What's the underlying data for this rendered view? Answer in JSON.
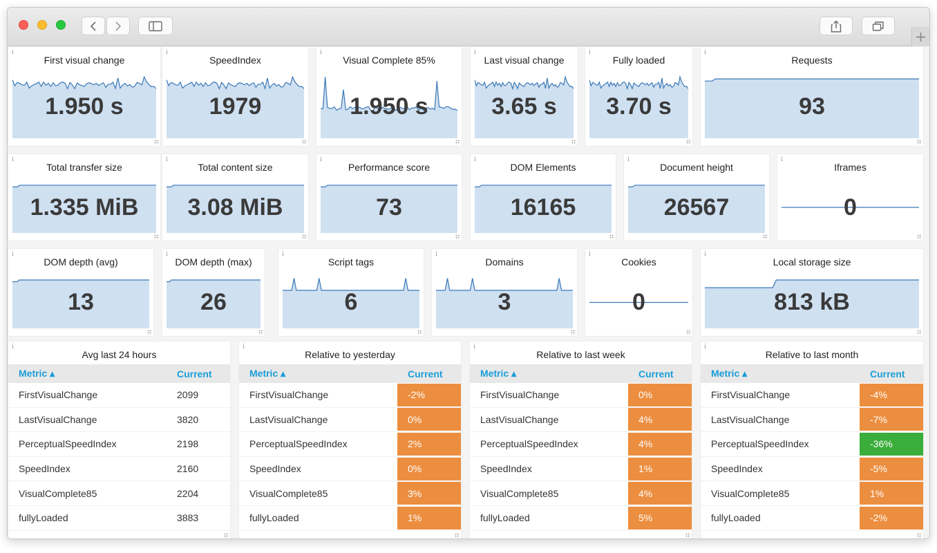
{
  "colors": {
    "spark_fill": "#cfe0f1",
    "spark_line": "#3b78b6",
    "orange": "#ec8e3f",
    "green": "#3aad3a",
    "header_blue": "#1a9ed8"
  },
  "toolbar": {
    "back_icon": "chevron-left-icon",
    "forward_icon": "chevron-right-icon",
    "sidebar_icon": "sidebar-icon",
    "share_icon": "share-icon",
    "tabs_icon": "tabs-icon",
    "new_tab": "+"
  },
  "info_glyph": "i",
  "panels": [
    {
      "title": "First visual change",
      "value": "1.950 s"
    },
    {
      "title": "SpeedIndex",
      "value": "1979"
    },
    {
      "title": "Visual Complete 85%",
      "value": "1.950 s"
    },
    {
      "title": "Last visual change",
      "value": "3.65 s"
    },
    {
      "title": "Fully loaded",
      "value": "3.70 s"
    },
    {
      "title": "Requests",
      "value": "93"
    },
    {
      "title": "Total transfer size",
      "value": "1.335 MiB"
    },
    {
      "title": "Total content size",
      "value": "3.08 MiB"
    },
    {
      "title": "Performance score",
      "value": "73"
    },
    {
      "title": "DOM Elements",
      "value": "16165"
    },
    {
      "title": "Document height",
      "value": "26567"
    },
    {
      "title": "Iframes",
      "value": "0"
    },
    {
      "title": "DOM depth (avg)",
      "value": "13"
    },
    {
      "title": "DOM depth (max)",
      "value": "26"
    },
    {
      "title": "Script tags",
      "value": "6"
    },
    {
      "title": "Domains",
      "value": "3"
    },
    {
      "title": "Cookies",
      "value": "0"
    },
    {
      "title": "Local storage size",
      "value": "813 kB"
    }
  ],
  "tables": [
    {
      "title": "Avg last 24 hours",
      "col_metric": "Metric ▴",
      "col_current": "Current",
      "rows": [
        {
          "metric": "FirstVisualChange",
          "current": "2099",
          "status": "none"
        },
        {
          "metric": "LastVisualChange",
          "current": "3820",
          "status": "none"
        },
        {
          "metric": "PerceptualSpeedIndex",
          "current": "2198",
          "status": "none"
        },
        {
          "metric": "SpeedIndex",
          "current": "2160",
          "status": "none"
        },
        {
          "metric": "VisualComplete85",
          "current": "2204",
          "status": "none"
        },
        {
          "metric": "fullyLoaded",
          "current": "3883",
          "status": "none"
        }
      ]
    },
    {
      "title": "Relative to yesterday",
      "col_metric": "Metric ▴",
      "col_current": "Current",
      "rows": [
        {
          "metric": "FirstVisualChange",
          "current": "-2%",
          "status": "orange"
        },
        {
          "metric": "LastVisualChange",
          "current": "0%",
          "status": "orange"
        },
        {
          "metric": "PerceptualSpeedIndex",
          "current": "2%",
          "status": "orange"
        },
        {
          "metric": "SpeedIndex",
          "current": "0%",
          "status": "orange"
        },
        {
          "metric": "VisualComplete85",
          "current": "3%",
          "status": "orange"
        },
        {
          "metric": "fullyLoaded",
          "current": "1%",
          "status": "orange"
        }
      ]
    },
    {
      "title": "Relative to last week",
      "col_metric": "Metric ▴",
      "col_current": "Current",
      "rows": [
        {
          "metric": "FirstVisualChange",
          "current": "0%",
          "status": "orange"
        },
        {
          "metric": "LastVisualChange",
          "current": "4%",
          "status": "orange"
        },
        {
          "metric": "PerceptualSpeedIndex",
          "current": "4%",
          "status": "orange"
        },
        {
          "metric": "SpeedIndex",
          "current": "1%",
          "status": "orange"
        },
        {
          "metric": "VisualComplete85",
          "current": "4%",
          "status": "orange"
        },
        {
          "metric": "fullyLoaded",
          "current": "5%",
          "status": "orange"
        }
      ]
    },
    {
      "title": "Relative to last month",
      "col_metric": "Metric ▴",
      "col_current": "Current",
      "rows": [
        {
          "metric": "FirstVisualChange",
          "current": "-4%",
          "status": "orange"
        },
        {
          "metric": "LastVisualChange",
          "current": "-7%",
          "status": "orange"
        },
        {
          "metric": "PerceptualSpeedIndex",
          "current": "-36%",
          "status": "green"
        },
        {
          "metric": "SpeedIndex",
          "current": "-5%",
          "status": "orange"
        },
        {
          "metric": "VisualComplete85",
          "current": "1%",
          "status": "orange"
        },
        {
          "metric": "fullyLoaded",
          "current": "-2%",
          "status": "orange"
        }
      ]
    }
  ]
}
